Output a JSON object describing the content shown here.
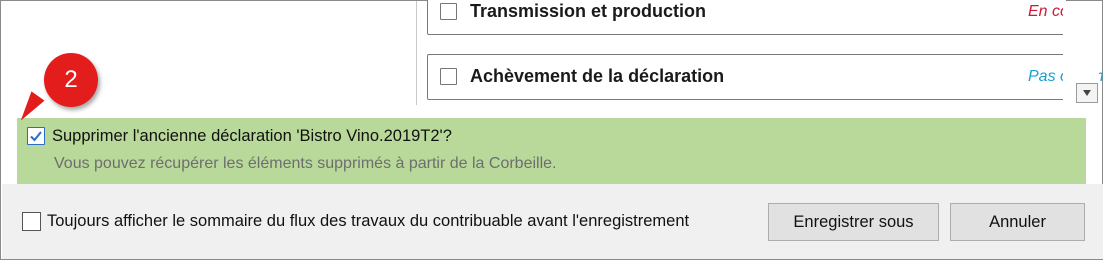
{
  "steps": [
    {
      "title": "Transmission et production",
      "status": "En co",
      "status_color": "#cc1a3a"
    },
    {
      "title": "Achèvement de la déclaration",
      "status": "Pas comme",
      "status_color": "#1aa0d0"
    }
  ],
  "callout": {
    "number": "2",
    "color": "#e31c1c"
  },
  "delete_option": {
    "checked": true,
    "label": "Supprimer l'ancienne déclaration 'Bistro Vino.2019T2'?",
    "hint": "Vous pouvez récupérer les éléments supprimés à partir de la Corbeille.",
    "band_color": "#b8d99a"
  },
  "footer": {
    "always_show_checked": false,
    "always_show_label": "Toujours afficher le sommaire du flux des travaux du contribuable avant l'enregistrement",
    "save_as_label": "Enregistrer sous",
    "cancel_label": "Annuler"
  },
  "icons": [
    "checkbox-icon",
    "checkmark-icon",
    "scroll-down-arrow-icon"
  ]
}
